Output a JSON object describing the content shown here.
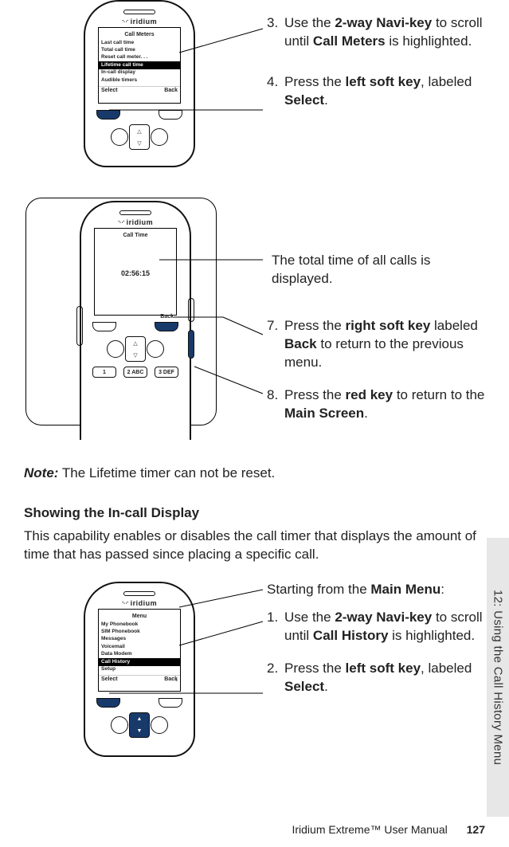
{
  "brand": "iridium",
  "phone1": {
    "screen_title": "Call Meters",
    "items": [
      "Last call time",
      "Total call time",
      "Reset call meter. . .",
      "Lifetime call time",
      "In-call display",
      "Audible timers"
    ],
    "highlight_index": 3,
    "soft_left": "Select",
    "soft_right": "Back"
  },
  "phone2": {
    "screen_title": "Call Time",
    "time_value": "02:56:15",
    "soft_right": "Back",
    "numrow": [
      "1",
      "2 ABC",
      "3 DEF"
    ]
  },
  "steps_a": [
    {
      "n": "3.",
      "parts": [
        "Use the ",
        "2-way Navi-key",
        " to scroll until ",
        "Call Meters",
        " is highlighted."
      ]
    },
    {
      "n": "4.",
      "parts": [
        "Press the ",
        "left soft key",
        ", labeled ",
        "Select",
        "."
      ]
    }
  ],
  "steps_b": [
    {
      "n": "",
      "parts": [
        "The total time of all calls is displayed."
      ]
    },
    {
      "n": "7.",
      "parts": [
        "Press the ",
        "right soft key",
        " labeled ",
        "Back",
        " to return to the previous menu."
      ]
    },
    {
      "n": "8.",
      "parts": [
        "Press the ",
        "red key",
        " to return to the ",
        "Main Screen",
        "."
      ]
    }
  ],
  "note_label": "Note:",
  "note_text": " The Lifetime timer can not be reset.",
  "heading": "Showing the In-call Display",
  "intro": "This capability enables or disables the call timer that displays the amount of time that has passed since placing a specific call.",
  "start_line_prefix": "Starting from the ",
  "start_line_bold": "Main Menu",
  "start_line_suffix": ":",
  "phone3": {
    "screen_title": "Menu",
    "items": [
      "My Phonebook",
      "SIM Phonebook",
      "Messages",
      "Voicemail",
      "Data Modem",
      "Call History",
      "Setup"
    ],
    "highlight_index": 5,
    "soft_left": "Select",
    "soft_right": "Back"
  },
  "steps_c": [
    {
      "n": "1.",
      "parts": [
        "Use the ",
        "2-way Navi-key",
        " to scroll until ",
        "Call History",
        " is highlighted."
      ]
    },
    {
      "n": "2.",
      "parts": [
        "Press the ",
        "left soft key",
        ", labeled ",
        "Select",
        "."
      ]
    }
  ],
  "sidetab": "12: Using the Call History Menu",
  "footer_title": "Iridium Extreme™ User Manual",
  "footer_page": "127"
}
